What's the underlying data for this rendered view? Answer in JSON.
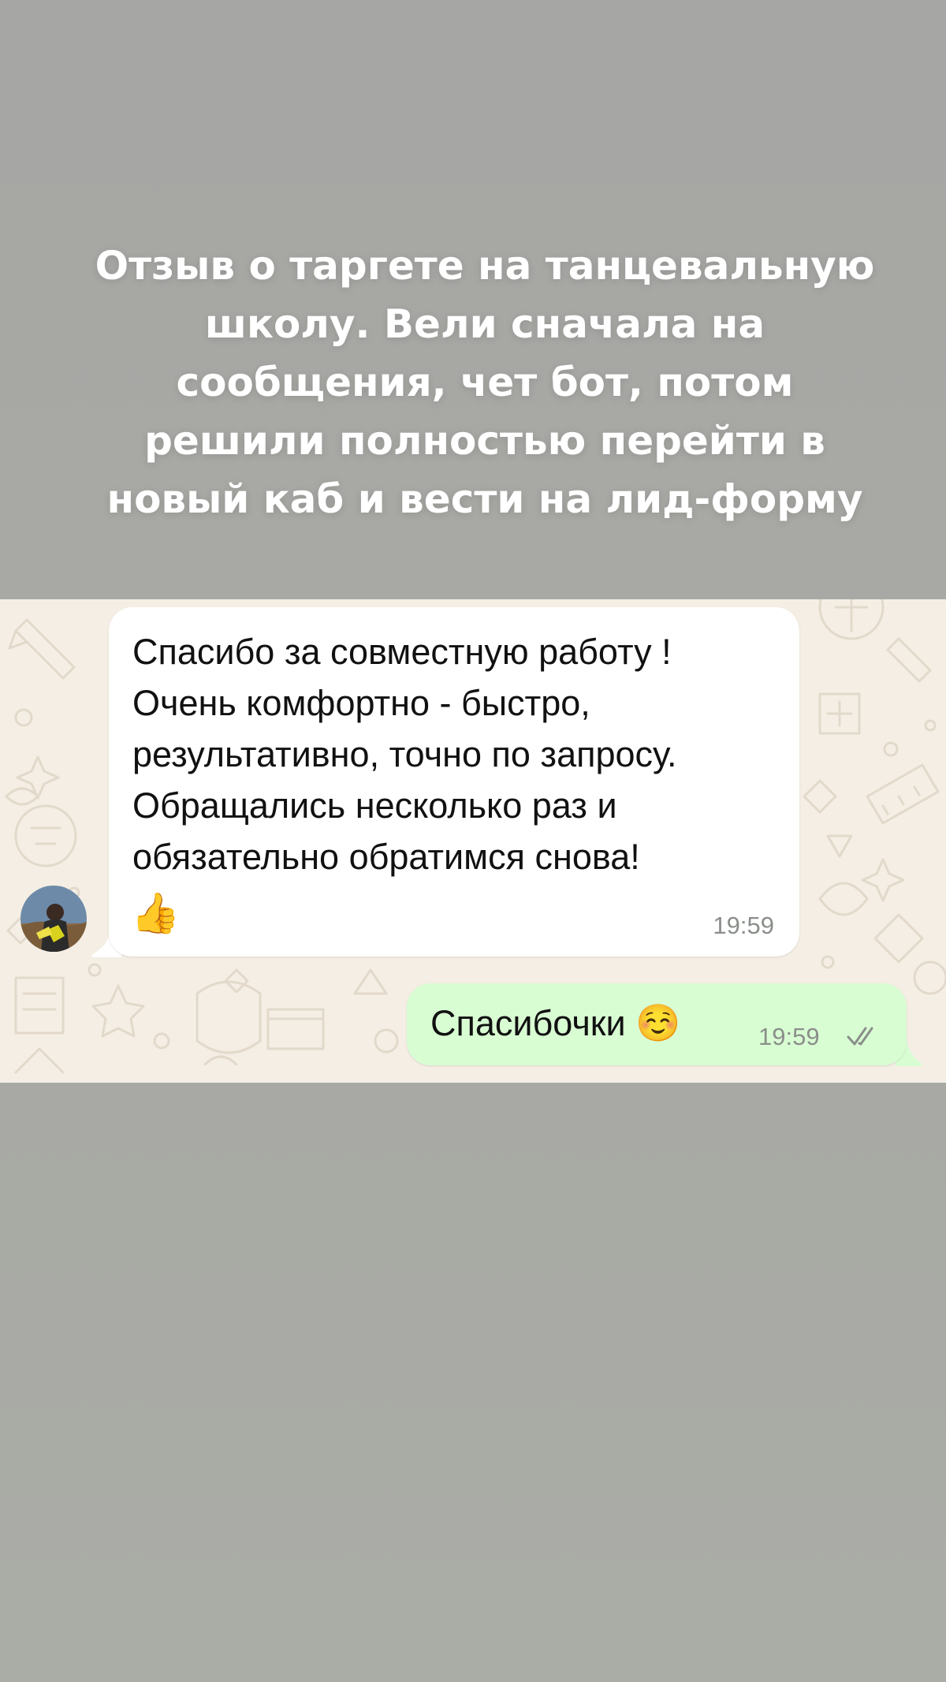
{
  "caption": {
    "line1": "Отзыв о таргете на танцевальную",
    "line2": "школу. Вели сначала на",
    "line3": "сообщения, чет бот, потом",
    "line4": "решили полностью перейти в",
    "line5": "новый каб и вести на лид-форму"
  },
  "chat": {
    "background_color": "#f4eee4",
    "incoming": {
      "text": "Спасибо за совместную работу !\nОчень комфортно  - быстро,\nрезультативно, точно по запросу.\nОбращались несколько раз и\nобязательно обратимся снова!",
      "emoji": "👍",
      "time": "19:59",
      "bubble_color": "#ffffff"
    },
    "outgoing": {
      "text": "Спасибочки",
      "emoji": "☺️",
      "time": "19:59",
      "status_icon": "double-check-icon",
      "bubble_color": "#d9fdd3"
    }
  }
}
